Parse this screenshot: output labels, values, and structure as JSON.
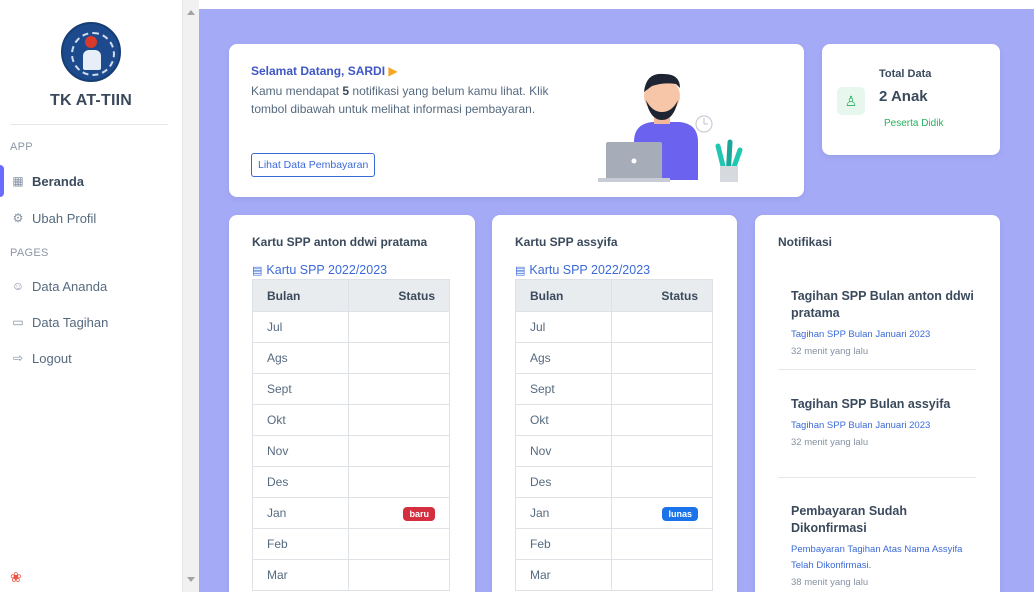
{
  "sidebar": {
    "brand": "TK AT-TIIN",
    "sections": [
      {
        "header": "APP"
      },
      {
        "header": "PAGES"
      }
    ],
    "items": [
      {
        "label": "Beranda",
        "icon": "grid-icon",
        "active": true
      },
      {
        "label": "Ubah Profil",
        "icon": "settings-icon",
        "active": false
      },
      {
        "label": "Data Ananda",
        "icon": "users-icon",
        "active": false
      },
      {
        "label": "Data Tagihan",
        "icon": "credit-card-icon",
        "active": false
      },
      {
        "label": "Logout",
        "icon": "logout-icon",
        "active": false
      }
    ],
    "footer_icon": "laravel-icon"
  },
  "welcome": {
    "title": "Selamat Datang, SARDI",
    "wave_icon": "wave-hand-icon",
    "desc_prefix": "Kamu mendapat ",
    "desc_count": "5",
    "desc_suffix": " notifikasi yang belum kamu lihat. Klik tombol dibawah untuk melihat informasi pembayaran.",
    "button": "Lihat Data Pembayaran"
  },
  "total": {
    "title": "Total Data",
    "value": "2 Anak",
    "subtitle": "Peserta Didik",
    "icon": "user-icon"
  },
  "spp_cards": [
    {
      "title_prefix": "Kartu SPP",
      "title_name": "anton ddwi pratama",
      "link": "Kartu SPP 2022/2023",
      "headers": [
        "Bulan",
        "Status"
      ],
      "rows": [
        {
          "bulan": "Jul",
          "status": ""
        },
        {
          "bulan": "Ags",
          "status": ""
        },
        {
          "bulan": "Sept",
          "status": ""
        },
        {
          "bulan": "Okt",
          "status": ""
        },
        {
          "bulan": "Nov",
          "status": ""
        },
        {
          "bulan": "Des",
          "status": ""
        },
        {
          "bulan": "Jan",
          "status": "baru"
        },
        {
          "bulan": "Feb",
          "status": ""
        },
        {
          "bulan": "Mar",
          "status": ""
        }
      ]
    },
    {
      "title_prefix": "Kartu SPP",
      "title_name": "assyifa",
      "link": "Kartu SPP 2022/2023",
      "headers": [
        "Bulan",
        "Status"
      ],
      "rows": [
        {
          "bulan": "Jul",
          "status": ""
        },
        {
          "bulan": "Ags",
          "status": ""
        },
        {
          "bulan": "Sept",
          "status": ""
        },
        {
          "bulan": "Okt",
          "status": ""
        },
        {
          "bulan": "Nov",
          "status": ""
        },
        {
          "bulan": "Des",
          "status": ""
        },
        {
          "bulan": "Jan",
          "status": "lunas"
        },
        {
          "bulan": "Feb",
          "status": ""
        },
        {
          "bulan": "Mar",
          "status": ""
        }
      ]
    }
  ],
  "notifications": {
    "title": "Notifikasi",
    "items": [
      {
        "title": "Tagihan SPP Bulan anton ddwi pratama",
        "desc": "Tagihan SPP Bulan Januari 2023",
        "time": "32 menit yang lalu"
      },
      {
        "title": "Tagihan SPP Bulan assyifa",
        "desc": "Tagihan SPP Bulan Januari 2023",
        "time": "32 menit yang lalu"
      },
      {
        "title": "Pembayaran Sudah Dikonfirmasi",
        "desc": "Pembayaran Tagihan Atas Nama Assyifa Telah Dikonfirmasi.",
        "time": "38 menit yang lalu"
      }
    ]
  },
  "colors": {
    "accent": "#696cff",
    "main_bg": "#a5aaf7",
    "link": "#3b6ad8",
    "success": "#26b15e",
    "danger": "#d32f3f",
    "primary": "#1a73e8"
  }
}
